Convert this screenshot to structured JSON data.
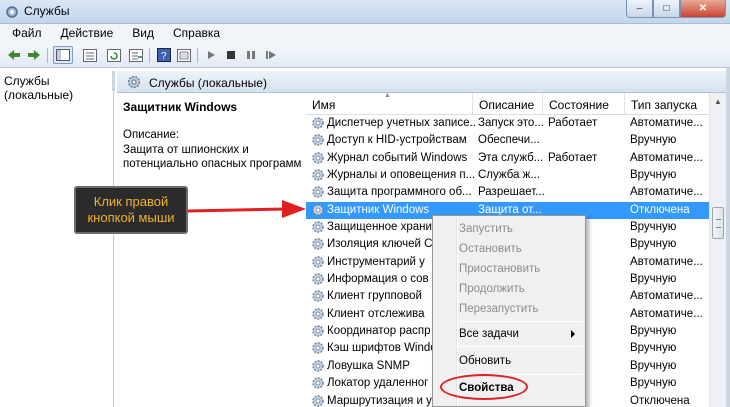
{
  "window": {
    "title": "Службы",
    "controls": {
      "minimize": "–",
      "maximize": "□",
      "close": "✕"
    }
  },
  "menu": [
    "Файл",
    "Действие",
    "Вид",
    "Справка"
  ],
  "tree": {
    "root": "Службы (локальные)"
  },
  "right_header": {
    "title": "Службы (локальные)"
  },
  "description_pane": {
    "service_name": "Защитник Windows",
    "label": "Описание:",
    "text_lines": [
      "Защита от шпионских  и",
      "потенциально опасных программ"
    ]
  },
  "table": {
    "columns": [
      "Имя",
      "Описание",
      "Состояние",
      "Тип запуска"
    ],
    "rows": [
      {
        "name": "Диспетчер учетных записе...",
        "desc": "Запуск это...",
        "state": "Работает",
        "start": "Автоматиче..."
      },
      {
        "name": "Доступ к HID-устройствам",
        "desc": "Обеспечи...",
        "state": "",
        "start": "Вручную"
      },
      {
        "name": "Журнал событий Windows",
        "desc": "Эта служб...",
        "state": "Работает",
        "start": "Автоматиче..."
      },
      {
        "name": "Журналы и оповещения п...",
        "desc": "Служба ж...",
        "state": "",
        "start": "Вручную"
      },
      {
        "name": "Защита программного об...",
        "desc": "Разрешает...",
        "state": "",
        "start": "Автоматиче..."
      },
      {
        "name": "Защитник Windows",
        "desc": "Защита от...",
        "state": "",
        "start": "Отключена",
        "selected": true
      },
      {
        "name": "Защищенное храни",
        "desc": "",
        "state": "",
        "start": "Вручную"
      },
      {
        "name": "Изоляция ключей С",
        "desc": "",
        "state": "",
        "start": "Вручную"
      },
      {
        "name": "Инструментарий у",
        "desc": "",
        "state": "",
        "start": "Автоматиче..."
      },
      {
        "name": "Информация о сов",
        "desc": "",
        "state": "",
        "start": "Вручную"
      },
      {
        "name": "Клиент групповой",
        "desc": "",
        "state": "",
        "start": "Автоматиче..."
      },
      {
        "name": "Клиент отслежива",
        "desc": "",
        "state": "",
        "start": "Автоматиче..."
      },
      {
        "name": "Координатор распр",
        "desc": "",
        "state": "",
        "start": "Вручную"
      },
      {
        "name": "Кэш шрифтов Windo",
        "desc": "",
        "state": "",
        "start": "Вручную"
      },
      {
        "name": "Ловушка SNMP",
        "desc": "",
        "state": "",
        "start": "Вручную"
      },
      {
        "name": "Локатор удаленног",
        "desc": "",
        "state": "",
        "start": "Вручную"
      },
      {
        "name": "Маршрутизация и у",
        "desc": "",
        "state": "",
        "start": "Отключена"
      }
    ]
  },
  "context_menu": {
    "start": "Запустить",
    "stop": "Остановить",
    "pause": "Приостановить",
    "resume": "Продолжить",
    "restart": "Перезапустить",
    "all_tasks": "Все задачи",
    "refresh": "Обновить",
    "properties": "Свойства"
  },
  "annotation": {
    "line1": "Клик правой",
    "line2": "кнопкой мыши"
  },
  "colors": {
    "selection": "#3399ff",
    "callout_text": "#f3b229",
    "arrow": "#e02020"
  }
}
